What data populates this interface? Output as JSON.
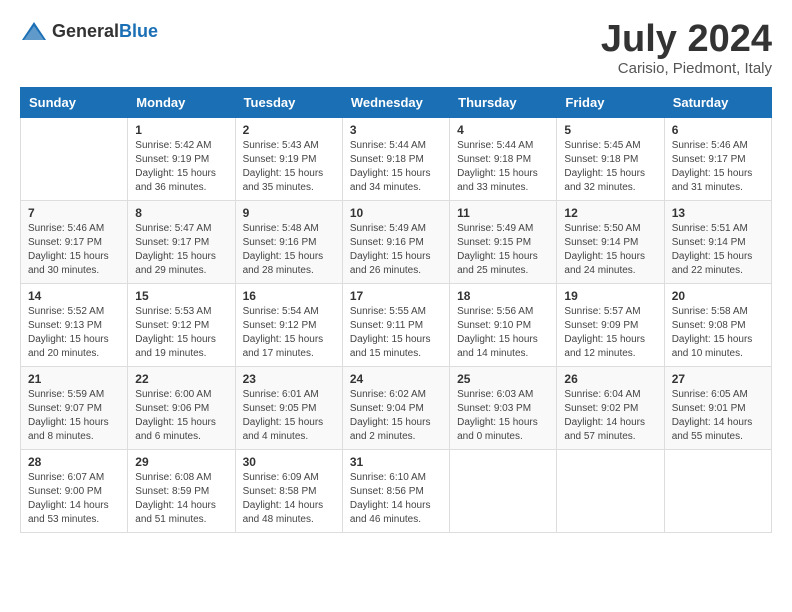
{
  "header": {
    "logo_general": "General",
    "logo_blue": "Blue",
    "month_title": "July 2024",
    "location": "Carisio, Piedmont, Italy"
  },
  "days_of_week": [
    "Sunday",
    "Monday",
    "Tuesday",
    "Wednesday",
    "Thursday",
    "Friday",
    "Saturday"
  ],
  "weeks": [
    [
      {
        "day": "",
        "info": ""
      },
      {
        "day": "1",
        "info": "Sunrise: 5:42 AM\nSunset: 9:19 PM\nDaylight: 15 hours\nand 36 minutes."
      },
      {
        "day": "2",
        "info": "Sunrise: 5:43 AM\nSunset: 9:19 PM\nDaylight: 15 hours\nand 35 minutes."
      },
      {
        "day": "3",
        "info": "Sunrise: 5:44 AM\nSunset: 9:18 PM\nDaylight: 15 hours\nand 34 minutes."
      },
      {
        "day": "4",
        "info": "Sunrise: 5:44 AM\nSunset: 9:18 PM\nDaylight: 15 hours\nand 33 minutes."
      },
      {
        "day": "5",
        "info": "Sunrise: 5:45 AM\nSunset: 9:18 PM\nDaylight: 15 hours\nand 32 minutes."
      },
      {
        "day": "6",
        "info": "Sunrise: 5:46 AM\nSunset: 9:17 PM\nDaylight: 15 hours\nand 31 minutes."
      }
    ],
    [
      {
        "day": "7",
        "info": "Sunrise: 5:46 AM\nSunset: 9:17 PM\nDaylight: 15 hours\nand 30 minutes."
      },
      {
        "day": "8",
        "info": "Sunrise: 5:47 AM\nSunset: 9:17 PM\nDaylight: 15 hours\nand 29 minutes."
      },
      {
        "day": "9",
        "info": "Sunrise: 5:48 AM\nSunset: 9:16 PM\nDaylight: 15 hours\nand 28 minutes."
      },
      {
        "day": "10",
        "info": "Sunrise: 5:49 AM\nSunset: 9:16 PM\nDaylight: 15 hours\nand 26 minutes."
      },
      {
        "day": "11",
        "info": "Sunrise: 5:49 AM\nSunset: 9:15 PM\nDaylight: 15 hours\nand 25 minutes."
      },
      {
        "day": "12",
        "info": "Sunrise: 5:50 AM\nSunset: 9:14 PM\nDaylight: 15 hours\nand 24 minutes."
      },
      {
        "day": "13",
        "info": "Sunrise: 5:51 AM\nSunset: 9:14 PM\nDaylight: 15 hours\nand 22 minutes."
      }
    ],
    [
      {
        "day": "14",
        "info": "Sunrise: 5:52 AM\nSunset: 9:13 PM\nDaylight: 15 hours\nand 20 minutes."
      },
      {
        "day": "15",
        "info": "Sunrise: 5:53 AM\nSunset: 9:12 PM\nDaylight: 15 hours\nand 19 minutes."
      },
      {
        "day": "16",
        "info": "Sunrise: 5:54 AM\nSunset: 9:12 PM\nDaylight: 15 hours\nand 17 minutes."
      },
      {
        "day": "17",
        "info": "Sunrise: 5:55 AM\nSunset: 9:11 PM\nDaylight: 15 hours\nand 15 minutes."
      },
      {
        "day": "18",
        "info": "Sunrise: 5:56 AM\nSunset: 9:10 PM\nDaylight: 15 hours\nand 14 minutes."
      },
      {
        "day": "19",
        "info": "Sunrise: 5:57 AM\nSunset: 9:09 PM\nDaylight: 15 hours\nand 12 minutes."
      },
      {
        "day": "20",
        "info": "Sunrise: 5:58 AM\nSunset: 9:08 PM\nDaylight: 15 hours\nand 10 minutes."
      }
    ],
    [
      {
        "day": "21",
        "info": "Sunrise: 5:59 AM\nSunset: 9:07 PM\nDaylight: 15 hours\nand 8 minutes."
      },
      {
        "day": "22",
        "info": "Sunrise: 6:00 AM\nSunset: 9:06 PM\nDaylight: 15 hours\nand 6 minutes."
      },
      {
        "day": "23",
        "info": "Sunrise: 6:01 AM\nSunset: 9:05 PM\nDaylight: 15 hours\nand 4 minutes."
      },
      {
        "day": "24",
        "info": "Sunrise: 6:02 AM\nSunset: 9:04 PM\nDaylight: 15 hours\nand 2 minutes."
      },
      {
        "day": "25",
        "info": "Sunrise: 6:03 AM\nSunset: 9:03 PM\nDaylight: 15 hours\nand 0 minutes."
      },
      {
        "day": "26",
        "info": "Sunrise: 6:04 AM\nSunset: 9:02 PM\nDaylight: 14 hours\nand 57 minutes."
      },
      {
        "day": "27",
        "info": "Sunrise: 6:05 AM\nSunset: 9:01 PM\nDaylight: 14 hours\nand 55 minutes."
      }
    ],
    [
      {
        "day": "28",
        "info": "Sunrise: 6:07 AM\nSunset: 9:00 PM\nDaylight: 14 hours\nand 53 minutes."
      },
      {
        "day": "29",
        "info": "Sunrise: 6:08 AM\nSunset: 8:59 PM\nDaylight: 14 hours\nand 51 minutes."
      },
      {
        "day": "30",
        "info": "Sunrise: 6:09 AM\nSunset: 8:58 PM\nDaylight: 14 hours\nand 48 minutes."
      },
      {
        "day": "31",
        "info": "Sunrise: 6:10 AM\nSunset: 8:56 PM\nDaylight: 14 hours\nand 46 minutes."
      },
      {
        "day": "",
        "info": ""
      },
      {
        "day": "",
        "info": ""
      },
      {
        "day": "",
        "info": ""
      }
    ]
  ]
}
